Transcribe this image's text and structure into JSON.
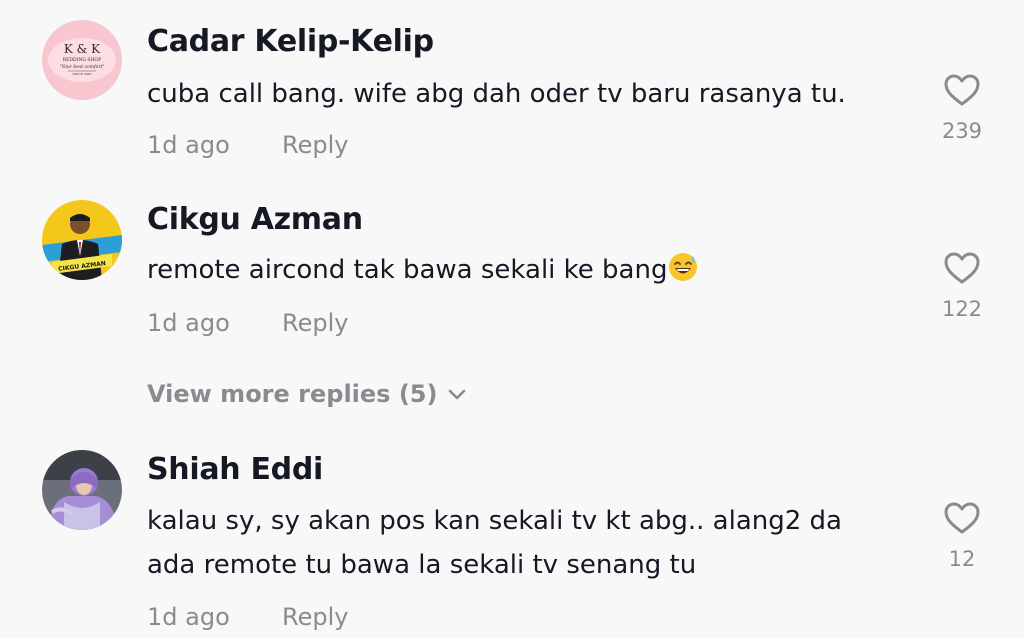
{
  "comments": [
    {
      "username": "Cadar Kelip-Kelip",
      "text": "cuba call bang. wife abg dah oder tv baru rasanya tu.",
      "time": "1d ago",
      "reply": "Reply",
      "likes": "239",
      "avatar": {
        "line1": "K & K",
        "line2": "BEDDING SHOP",
        "line3": "\"Your best comfort\"",
        "line4": "SINCE 2020"
      }
    },
    {
      "username": "Cikgu Azman",
      "text": "remote aircond tak bawa sekali ke bang",
      "text_emoji": "😅",
      "time": "1d ago",
      "reply": "Reply",
      "likes": "122",
      "avatar": {
        "banner": "CIKGU AZMAN"
      }
    },
    {
      "username": "Shiah Eddi",
      "text_line1": "kalau sy, sy akan pos kan sekali tv kt abg.. alang2 da",
      "text_line2": "ada remote tu bawa la sekali tv senang tu",
      "time": "1d ago",
      "reply": "Reply",
      "likes": "12"
    }
  ],
  "view_more": "View more replies (5)",
  "icons": {
    "like": "heart-outline-icon",
    "expand": "chevron-down-icon"
  },
  "colors": {
    "background": "#f8f8f8",
    "text": "#161823",
    "muted": "#8a8b91"
  }
}
